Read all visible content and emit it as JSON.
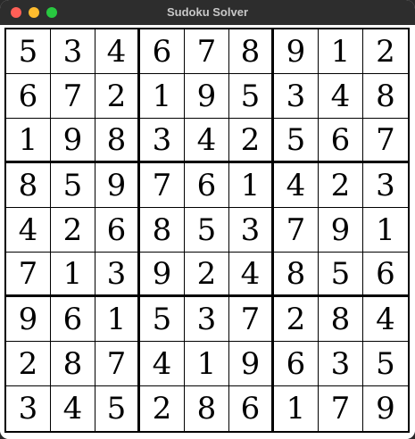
{
  "window": {
    "title": "Sudoku Solver",
    "traffic_light_colors": {
      "close": "#ff5f57",
      "minimize": "#febc2e",
      "zoom": "#28c840"
    }
  },
  "board": {
    "rows": [
      [
        "5",
        "3",
        "4",
        "6",
        "7",
        "8",
        "9",
        "1",
        "2"
      ],
      [
        "6",
        "7",
        "2",
        "1",
        "9",
        "5",
        "3",
        "4",
        "8"
      ],
      [
        "1",
        "9",
        "8",
        "3",
        "4",
        "2",
        "5",
        "6",
        "7"
      ],
      [
        "8",
        "5",
        "9",
        "7",
        "6",
        "1",
        "4",
        "2",
        "3"
      ],
      [
        "4",
        "2",
        "6",
        "8",
        "5",
        "3",
        "7",
        "9",
        "1"
      ],
      [
        "7",
        "1",
        "3",
        "9",
        "2",
        "4",
        "8",
        "5",
        "6"
      ],
      [
        "9",
        "6",
        "1",
        "5",
        "3",
        "7",
        "2",
        "8",
        "4"
      ],
      [
        "2",
        "8",
        "7",
        "4",
        "1",
        "9",
        "6",
        "3",
        "5"
      ],
      [
        "3",
        "4",
        "5",
        "2",
        "8",
        "6",
        "1",
        "7",
        "9"
      ]
    ]
  }
}
